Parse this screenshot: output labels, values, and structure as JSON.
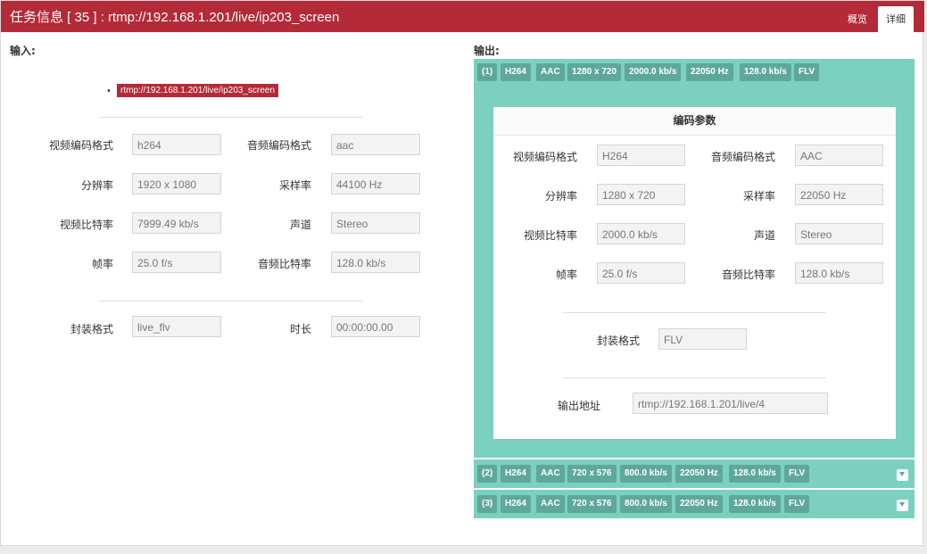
{
  "header": {
    "title": "任务信息 [ 35 ] : rtmp://192.168.1.201/live/ip203_screen",
    "tabs": {
      "overview": "概览",
      "detail": "详细"
    }
  },
  "input": {
    "label": "输入:",
    "url": "rtmp://192.168.1.201/live/ip203_screen",
    "fields": {
      "video_codec": {
        "label": "视频编码格式",
        "value": "h264"
      },
      "audio_codec": {
        "label": "音频编码格式",
        "value": "aac"
      },
      "resolution": {
        "label": "分辨率",
        "value": "1920 x 1080"
      },
      "sample_rate": {
        "label": "采样率",
        "value": "44100 Hz"
      },
      "video_bitrate": {
        "label": "视频比特率",
        "value": "7999.49 kb/s"
      },
      "channel": {
        "label": "声道",
        "value": "Stereo"
      },
      "frame_rate": {
        "label": "帧率",
        "value": "25.0 f/s"
      },
      "audio_bitrate": {
        "label": "音频比特率",
        "value": "128.0 kb/s"
      },
      "container": {
        "label": "封装格式",
        "value": "live_flv"
      },
      "duration": {
        "label": "时长",
        "value": "00:00:00.00"
      }
    }
  },
  "output": {
    "label": "输出:",
    "items": [
      {
        "index": "(1)",
        "vcodec": "H264",
        "acodec": "AAC",
        "resolution": "1280 x 720",
        "vbitrate": "2000.0 kb/s",
        "samplerate": "22050 Hz",
        "abitrate": "128.0 kb/s",
        "format": "FLV"
      },
      {
        "index": "(2)",
        "vcodec": "H264",
        "acodec": "AAC",
        "resolution": "720 x 576",
        "vbitrate": "800.0 kb/s",
        "samplerate": "22050 Hz",
        "abitrate": "128.0 kb/s",
        "format": "FLV"
      },
      {
        "index": "(3)",
        "vcodec": "H264",
        "acodec": "AAC",
        "resolution": "720 x 576",
        "vbitrate": "800.0 kb/s",
        "samplerate": "22050 Hz",
        "abitrate": "128.0 kb/s",
        "format": "FLV"
      }
    ],
    "params": {
      "title": "编码参数",
      "video_codec": {
        "label": "视频编码格式",
        "value": "H264"
      },
      "audio_codec": {
        "label": "音频编码格式",
        "value": "AAC"
      },
      "resolution": {
        "label": "分辨率",
        "value": "1280 x 720"
      },
      "sample_rate": {
        "label": "采样率",
        "value": "22050 Hz"
      },
      "video_bitrate": {
        "label": "视频比特率",
        "value": "2000.0 kb/s"
      },
      "channel": {
        "label": "声道",
        "value": "Stereo"
      },
      "frame_rate": {
        "label": "帧率",
        "value": "25.0 f/s"
      },
      "audio_bitrate": {
        "label": "音频比特率",
        "value": "128.0 kb/s"
      },
      "container": {
        "label": "封装格式",
        "value": "FLV"
      },
      "output_url": {
        "label": "输出地址",
        "value": "rtmp://192.168.1.201/live/4"
      }
    }
  }
}
